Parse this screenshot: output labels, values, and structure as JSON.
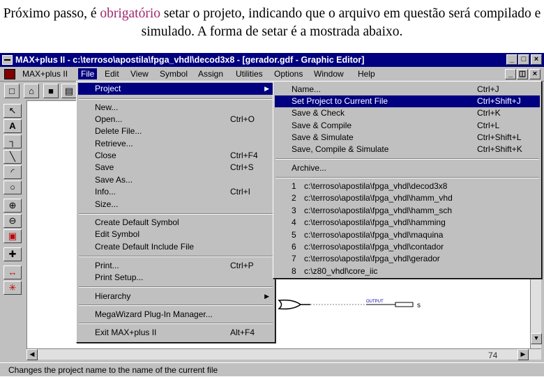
{
  "caption": {
    "part1": "Próximo passo, é ",
    "highlight": "obrigatório",
    "part2": " setar o projeto, indicando que o arquivo em questão será compilado e simulado. A forma de setar é a mostrada abaixo."
  },
  "window": {
    "title": "MAX+plus II - c:\\terroso\\apostila\\fpga_vhdl\\decod3x8 - [gerador.gdf - Graphic Editor]",
    "minimize": "_",
    "maximize": "□",
    "close": "×",
    "restore": "◫"
  },
  "menubar": [
    "MAX+plus II",
    "File",
    "Edit",
    "View",
    "Symbol",
    "Assign",
    "Utilities",
    "Options",
    "Window",
    "Help"
  ],
  "file_menu": {
    "project": "Project",
    "items": [
      {
        "label": "New...",
        "shortcut": ""
      },
      {
        "label": "Open...",
        "shortcut": "Ctrl+O"
      },
      {
        "label": "Delete File...",
        "shortcut": ""
      },
      {
        "label": "Retrieve...",
        "shortcut": ""
      },
      {
        "label": "Close",
        "shortcut": "Ctrl+F4"
      },
      {
        "label": "Save",
        "shortcut": "Ctrl+S"
      },
      {
        "label": "Save As...",
        "shortcut": ""
      },
      {
        "label": "Info...",
        "shortcut": "Ctrl+I"
      },
      {
        "label": "Size...",
        "shortcut": ""
      },
      {
        "label": "Create Default Symbol",
        "shortcut": ""
      },
      {
        "label": "Edit Symbol",
        "shortcut": ""
      },
      {
        "label": "Create Default Include File",
        "shortcut": ""
      },
      {
        "label": "Print...",
        "shortcut": "Ctrl+P"
      },
      {
        "label": "Print Setup...",
        "shortcut": ""
      },
      {
        "label": "Hierarchy",
        "shortcut": ""
      },
      {
        "label": "MegaWizard Plug-In Manager...",
        "shortcut": ""
      },
      {
        "label": "Exit MAX+plus II",
        "shortcut": "Alt+F4"
      }
    ]
  },
  "project_menu": {
    "items": [
      {
        "label": "Name...",
        "shortcut": "Ctrl+J"
      },
      {
        "label": "Set Project to Current File",
        "shortcut": "Ctrl+Shift+J"
      },
      {
        "label": "Save & Check",
        "shortcut": "Ctrl+K"
      },
      {
        "label": "Save & Compile",
        "shortcut": "Ctrl+L"
      },
      {
        "label": "Save & Simulate",
        "shortcut": "Ctrl+Shift+L"
      },
      {
        "label": "Save, Compile & Simulate",
        "shortcut": "Ctrl+Shift+K"
      },
      {
        "label": "Archive...",
        "shortcut": ""
      }
    ],
    "recent": [
      {
        "num": "1",
        "path": "c:\\terroso\\apostila\\fpga_vhdl\\decod3x8"
      },
      {
        "num": "2",
        "path": "c:\\terroso\\apostila\\fpga_vhdl\\hamm_vhd"
      },
      {
        "num": "3",
        "path": "c:\\terroso\\apostila\\fpga_vhdl\\hamm_sch"
      },
      {
        "num": "4",
        "path": "c:\\terroso\\apostila\\fpga_vhdl\\hamming"
      },
      {
        "num": "5",
        "path": "c:\\terroso\\apostila\\fpga_vhdl\\maquina"
      },
      {
        "num": "6",
        "path": "c:\\terroso\\apostila\\fpga_vhdl\\contador"
      },
      {
        "num": "7",
        "path": "c:\\terroso\\apostila\\fpga_vhdl\\gerador"
      },
      {
        "num": "8",
        "path": "c:\\z80_vhdl\\core_iic"
      }
    ]
  },
  "schematic": {
    "output_label": "OUTPUT",
    "pin_name": "s"
  },
  "page_number": "74",
  "status_text": "Changes the project name to the name of the current file"
}
